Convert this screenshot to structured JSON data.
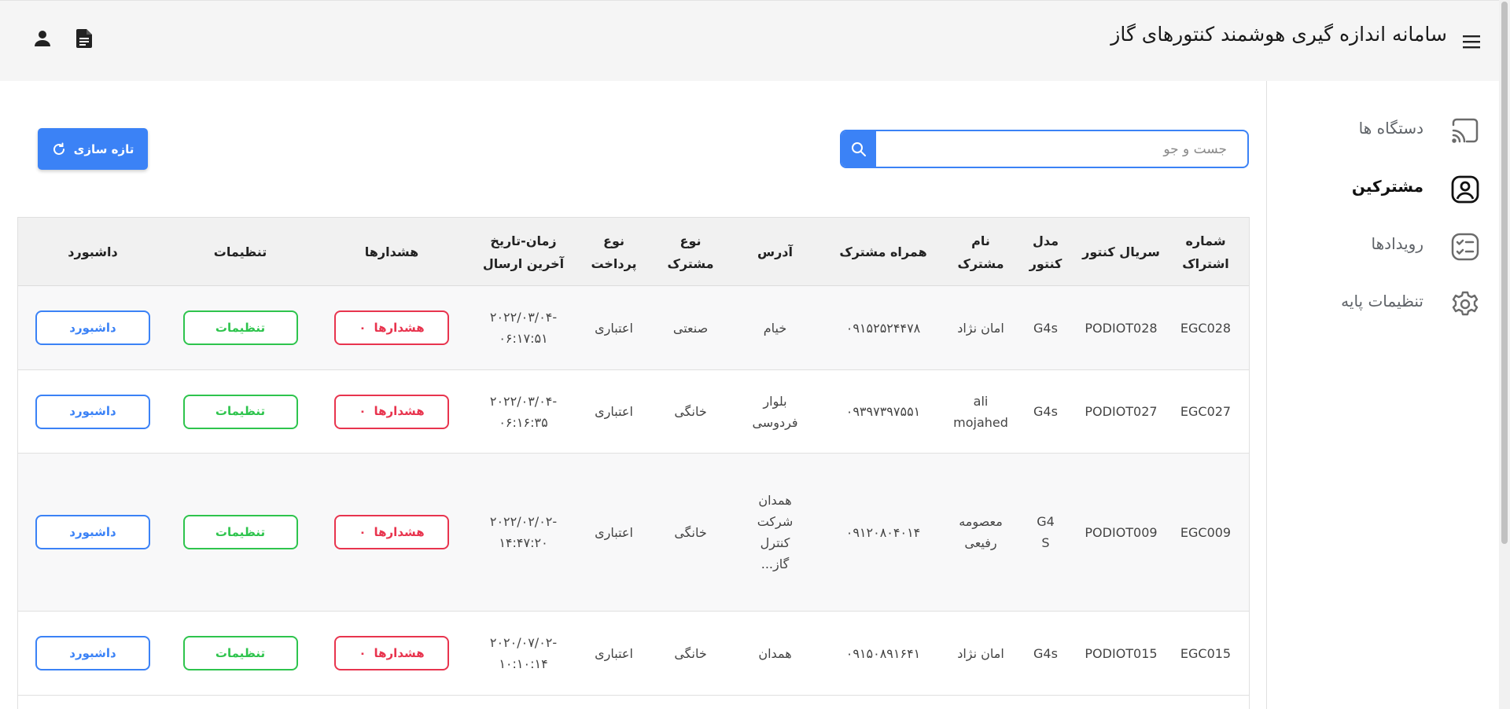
{
  "header": {
    "title": "سامانه اندازه گیری هوشمند کنتورهای گاز",
    "menu_icon": "hamburger-menu-icon",
    "doc_icon": "document-icon",
    "user_icon": "user-icon"
  },
  "sidebar": {
    "items": [
      {
        "label": "دستگاه ها",
        "icon": "cast-icon",
        "active": false
      },
      {
        "label": "مشترکین",
        "icon": "user-circle-icon",
        "active": true
      },
      {
        "label": "رویدادها",
        "icon": "checklist-icon",
        "active": false
      },
      {
        "label": "تنظیمات پایه",
        "icon": "gear-icon",
        "active": false
      }
    ]
  },
  "search": {
    "placeholder": "جست و جو",
    "value": ""
  },
  "toolbar": {
    "refresh_label": "تازه سازی"
  },
  "table": {
    "headers": {
      "subscription_no": [
        "شماره",
        "اشتراک"
      ],
      "meter_serial": [
        "سریال کنتور"
      ],
      "meter_model": [
        "مدل",
        "کنتور"
      ],
      "subscriber_name": [
        "نام",
        "مشترک"
      ],
      "subscriber_phone": [
        "همراه مشترک"
      ],
      "address": [
        "آدرس"
      ],
      "subscriber_type": [
        "نوع",
        "مشترک"
      ],
      "payment_type": [
        "نوع",
        "پرداخت"
      ],
      "last_send": [
        "زمان-تاریخ",
        "آخرین ارسال"
      ],
      "alerts": [
        "هشدارها"
      ],
      "settings": [
        "تنظیمات"
      ],
      "dashboard": [
        "داشبورد"
      ]
    },
    "rows": [
      {
        "subscription_no": "EGC028",
        "meter_serial": "PODIOT028",
        "meter_model": [
          "G4s"
        ],
        "subscriber_name": [
          "امان نژاد"
        ],
        "subscriber_phone": "۰۹۱۵۲۵۲۴۴۷۸",
        "address": [
          "خیام"
        ],
        "subscriber_type": "صنعتی",
        "payment_type": "اعتباری",
        "last_send": [
          "-۲۰۲۲/۰۳/۰۴",
          "۰۶:۱۷:۵۱"
        ],
        "alerts_count": "۰",
        "alerts_label": "هشدارها",
        "settings_label": "تنظیمات",
        "dashboard_label": "داشبورد"
      },
      {
        "subscription_no": "EGC027",
        "meter_serial": "PODIOT027",
        "meter_model": [
          "G4s"
        ],
        "subscriber_name": [
          "ali",
          "mojahed"
        ],
        "subscriber_phone": "۰۹۳۹۷۳۹۷۵۵۱",
        "address": [
          "بلوار",
          "فردوسی"
        ],
        "subscriber_type": "خانگی",
        "payment_type": "اعتباری",
        "last_send": [
          "-۲۰۲۲/۰۳/۰۴",
          "۰۶:۱۶:۳۵"
        ],
        "alerts_count": "۰",
        "alerts_label": "هشدارها",
        "settings_label": "تنظیمات",
        "dashboard_label": "داشبورد"
      },
      {
        "subscription_no": "EGC009",
        "meter_serial": "PODIOT009",
        "meter_model": [
          "G4",
          "S"
        ],
        "subscriber_name": [
          "معصومه",
          "رفیعی"
        ],
        "subscriber_phone": "۰۹۱۲۰۸۰۴۰۱۴",
        "address": [
          "همدان",
          "شرکت",
          "کنترل",
          "گاز..."
        ],
        "subscriber_type": "خانگی",
        "payment_type": "اعتباری",
        "last_send": [
          "-۲۰۲۲/۰۲/۰۲",
          "۱۴:۴۷:۲۰"
        ],
        "alerts_count": "۰",
        "alerts_label": "هشدارها",
        "settings_label": "تنظیمات",
        "dashboard_label": "داشبورد"
      },
      {
        "subscription_no": "EGC015",
        "meter_serial": "PODIOT015",
        "meter_model": [
          "G4s"
        ],
        "subscriber_name": [
          "امان نژاد"
        ],
        "subscriber_phone": "۰۹۱۵۰۸۹۱۶۴۱",
        "address": [
          "همدان"
        ],
        "subscriber_type": "خانگی",
        "payment_type": "اعتباری",
        "last_send": [
          "-۲۰۲۰/۰۷/۰۲",
          "۱۰:۱۰:۱۴"
        ],
        "alerts_count": "۰",
        "alerts_label": "هشدارها",
        "settings_label": "تنظیمات",
        "dashboard_label": "داشبورد"
      }
    ]
  },
  "colors": {
    "primary": "#3b82f6",
    "alert": "#e8344e",
    "success": "#2ec44d",
    "header_bg": "#f5f5f5"
  }
}
